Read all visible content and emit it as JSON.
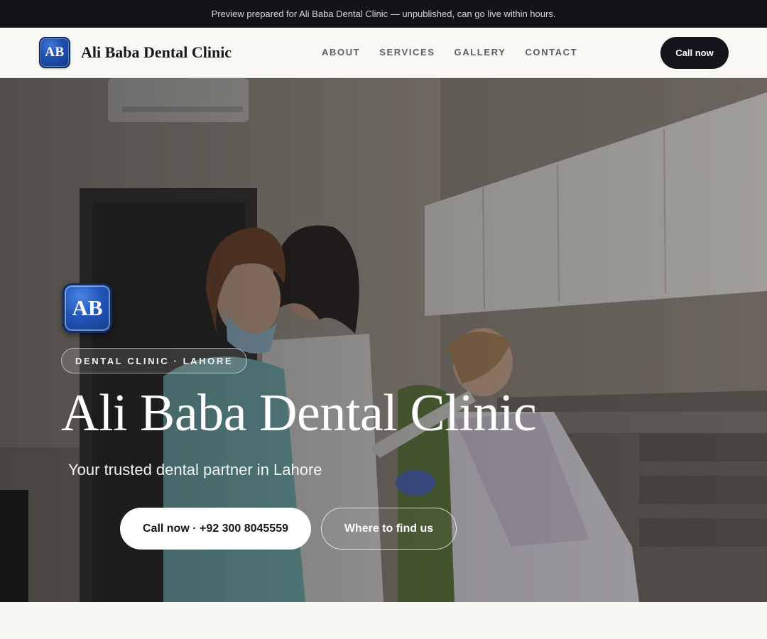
{
  "banner": {
    "text": "Preview prepared for Ali Baba Dental Clinic — unpublished, can go live within hours."
  },
  "header": {
    "logo_initials": "AB",
    "brand_name": "Ali Baba Dental Clinic",
    "nav": [
      {
        "label": "ABOUT"
      },
      {
        "label": "SERVICES"
      },
      {
        "label": "GALLERY"
      },
      {
        "label": "CONTACT"
      }
    ],
    "cta_label": "Call now"
  },
  "hero": {
    "logo_initials": "AB",
    "eyebrow": "DENTAL CLINIC · LAHORE",
    "title": "Ali Baba Dental Clinic",
    "subtitle": "Your trusted dental partner in Lahore",
    "primary_button": "Call now · +92 300 8045559",
    "secondary_button": "Where to find us",
    "background_image": "dental-clinic-photo"
  },
  "colors": {
    "banner_bg": "#121418",
    "accent_dark": "#14161b",
    "logo_blue": "#2156b8",
    "page_bg": "#f8f7f4"
  }
}
